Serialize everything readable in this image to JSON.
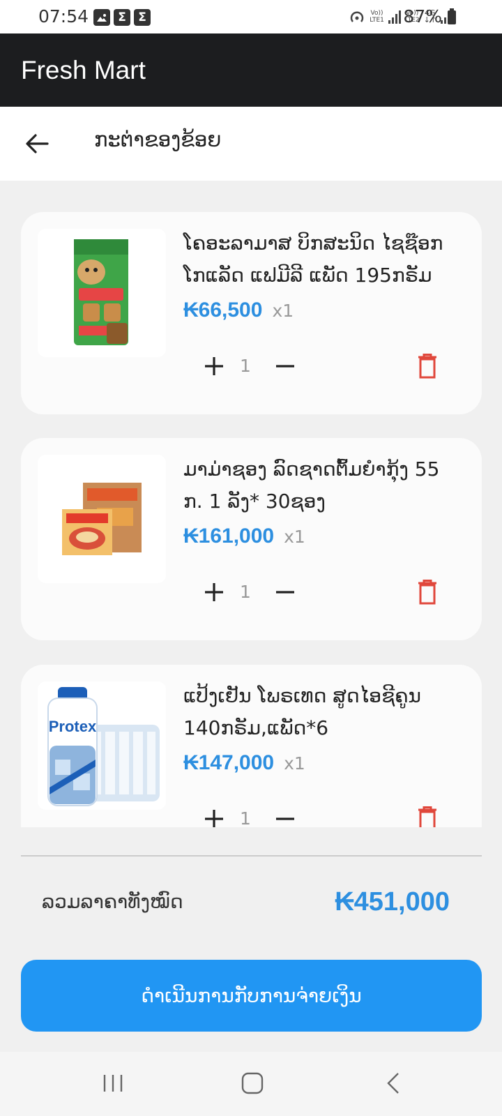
{
  "status_bar": {
    "time": "07:54",
    "notification_icons": [
      "image-icon",
      "sigma-icon",
      "sigma-icon"
    ],
    "sim1_label_top": "Vo))",
    "sim1_label_bottom": "LTE1",
    "sim2_label_top": "Vo))",
    "sim2_label_bottom": "LTE2",
    "network": "4G",
    "battery": "87%"
  },
  "app": {
    "title": "Fresh Mart"
  },
  "header": {
    "title": "ກະຕ່າຂອງຂ້ອຍ"
  },
  "cart": {
    "items": [
      {
        "name": "ໂຄອະລາມາສ ບິກສະນິດ ໄຊຊ໊ອກ ໂກແລັດ ແຟມີລີ ແພັດ 195ກຣັມ",
        "price": "₭66,500",
        "qty_label": "x1",
        "quantity": "1",
        "image_icon": "koala-biscuit-box"
      },
      {
        "name": "ມາມ່າຊອງ ລົດຊາດຕົ້ມຍຳກຸ້ງ 55 ກ. 1 ລັງ* 30ຊອງ",
        "price": "₭161,000",
        "qty_label": "x1",
        "quantity": "1",
        "image_icon": "mama-noodle-box"
      },
      {
        "name": "ແປ້ງເຢັນ ໂພຣເທດ ສູດໄອຊີຄູນ 140ກຣັມ,ແພັດ*6",
        "price": "₭147,000",
        "qty_label": "x1",
        "quantity": "1",
        "image_icon": "protex-powder-pack",
        "image_brand_text": "Protex"
      }
    ]
  },
  "summary": {
    "total_label": "ລວມລາຄາທັງໝົດ",
    "total_value": "₭451,000"
  },
  "checkout": {
    "label": "ດຳເນີນການກັບການຈ່າຍເງິນ"
  },
  "colors": {
    "appbar": "#1c1d1f",
    "accent": "#2196f3",
    "price": "#2d8fe0",
    "delete": "#e0473b"
  }
}
